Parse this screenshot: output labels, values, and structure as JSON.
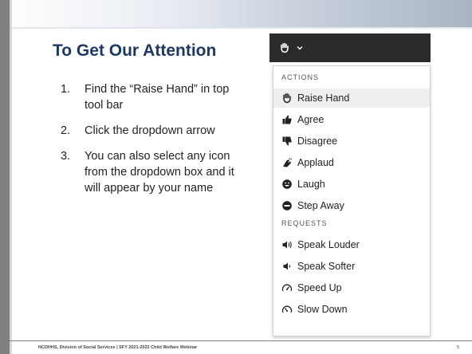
{
  "slide": {
    "title": "To Get Our Attention",
    "steps": [
      {
        "num": "1.",
        "text": "Find the “Raise Hand” in top tool bar"
      },
      {
        "num": "2.",
        "text": "Click the dropdown arrow"
      },
      {
        "num": "3.",
        "text": "You can also select any icon from the dropdown box and it will appear by your name"
      }
    ],
    "footer": "NCDHHS, Division of Social Services | SFY 2021-2022 Child Welfare Webinar",
    "page_number": "5"
  },
  "dropdown": {
    "header_icons": [
      "raise-hand-icon",
      "chevron-down-icon"
    ],
    "actions_label": "ACTIONS",
    "actions": [
      {
        "label": "Raise Hand",
        "icon": "raise-hand-icon",
        "highlighted": true
      },
      {
        "label": "Agree",
        "icon": "thumbs-up-icon"
      },
      {
        "label": "Disagree",
        "icon": "thumbs-down-icon"
      },
      {
        "label": "Applaud",
        "icon": "applaud-icon"
      },
      {
        "label": "Laugh",
        "icon": "laugh-icon"
      },
      {
        "label": "Step Away",
        "icon": "step-away-icon"
      }
    ],
    "requests_label": "REQUESTS",
    "requests": [
      {
        "label": "Speak Louder",
        "icon": "speaker-loud-icon"
      },
      {
        "label": "Speak Softer",
        "icon": "speaker-soft-icon"
      },
      {
        "label": "Speed Up",
        "icon": "speed-up-icon"
      },
      {
        "label": "Slow Down",
        "icon": "slow-down-icon"
      }
    ]
  }
}
